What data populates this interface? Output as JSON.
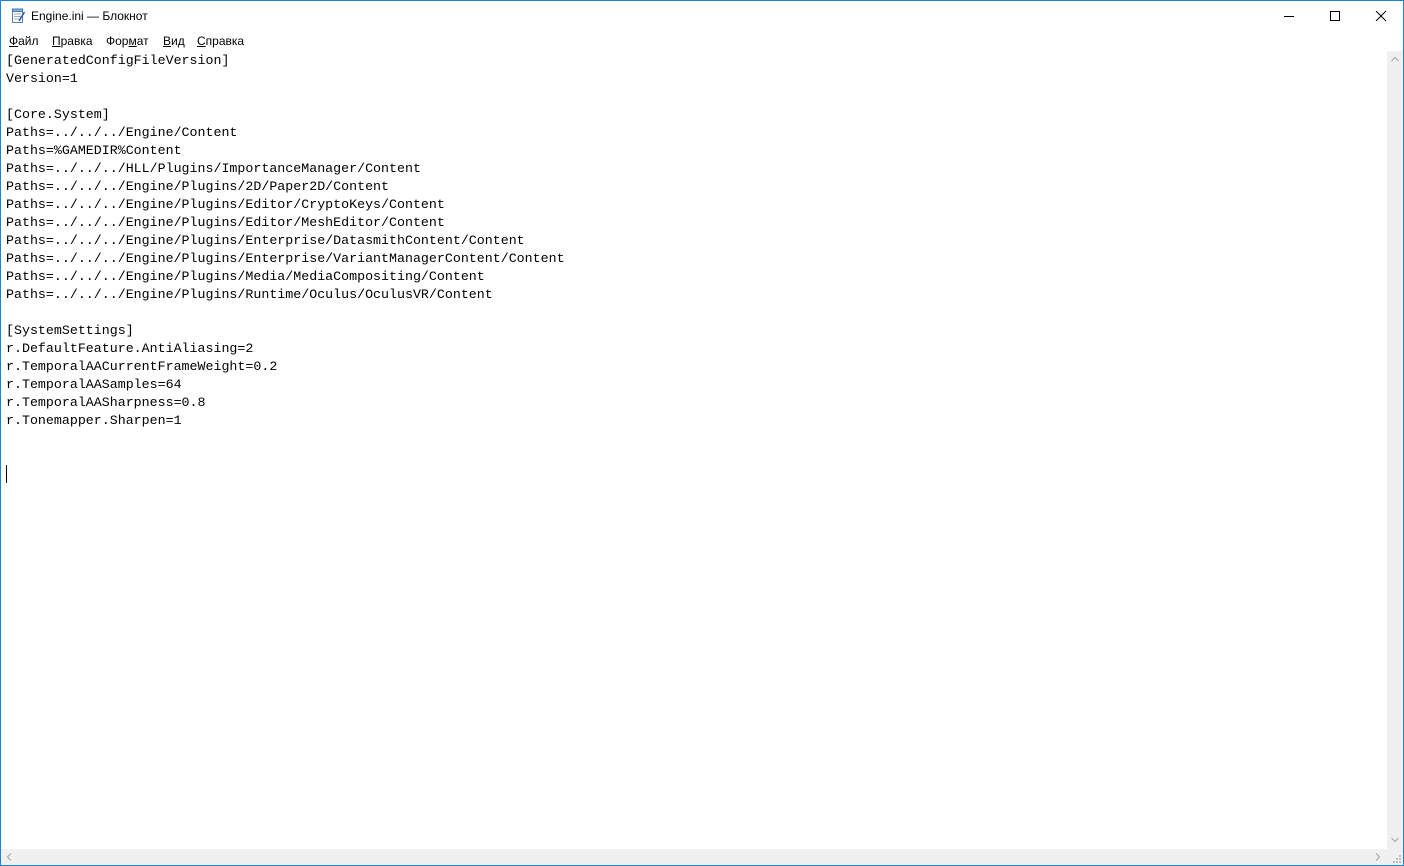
{
  "window": {
    "title": "Engine.ini — Блокнот",
    "accent_color": "#1883d7",
    "icons": {
      "app": "notepad-icon",
      "minimize": "minimize-icon",
      "maximize": "maximize-icon",
      "close": "close-icon"
    }
  },
  "menubar": {
    "items": [
      {
        "prefix": "",
        "accel": "Ф",
        "rest": "айл"
      },
      {
        "prefix": "",
        "accel": "П",
        "rest": "равка"
      },
      {
        "prefix": "Фор",
        "accel": "м",
        "rest": "ат"
      },
      {
        "prefix": "",
        "accel": "В",
        "rest": "ид"
      },
      {
        "prefix": "",
        "accel": "С",
        "rest": "правка"
      }
    ]
  },
  "editor": {
    "lines": [
      "[GeneratedConfigFileVersion]",
      "Version=1",
      "",
      "[Core.System]",
      "Paths=../../../Engine/Content",
      "Paths=%GAMEDIR%Content",
      "Paths=../../../HLL/Plugins/ImportanceManager/Content",
      "Paths=../../../Engine/Plugins/2D/Paper2D/Content",
      "Paths=../../../Engine/Plugins/Editor/CryptoKeys/Content",
      "Paths=../../../Engine/Plugins/Editor/MeshEditor/Content",
      "Paths=../../../Engine/Plugins/Enterprise/DatasmithContent/Content",
      "Paths=../../../Engine/Plugins/Enterprise/VariantManagerContent/Content",
      "Paths=../../../Engine/Plugins/Media/MediaCompositing/Content",
      "Paths=../../../Engine/Plugins/Runtime/Oculus/OculusVR/Content",
      "",
      "[SystemSettings]",
      "r.DefaultFeature.AntiAliasing=2",
      "r.TemporalAACurrentFrameWeight=0.2",
      "r.TemporalAASamples=64",
      "r.TemporalAASharpness=0.8",
      "r.Tonemapper.Sharpen=1",
      "",
      "",
      ""
    ]
  },
  "scrollbars": {
    "icons": [
      "scroll-up-arrow-icon",
      "scroll-down-arrow-icon",
      "scroll-left-arrow-icon",
      "scroll-right-arrow-icon",
      "resize-grip-icon"
    ]
  }
}
